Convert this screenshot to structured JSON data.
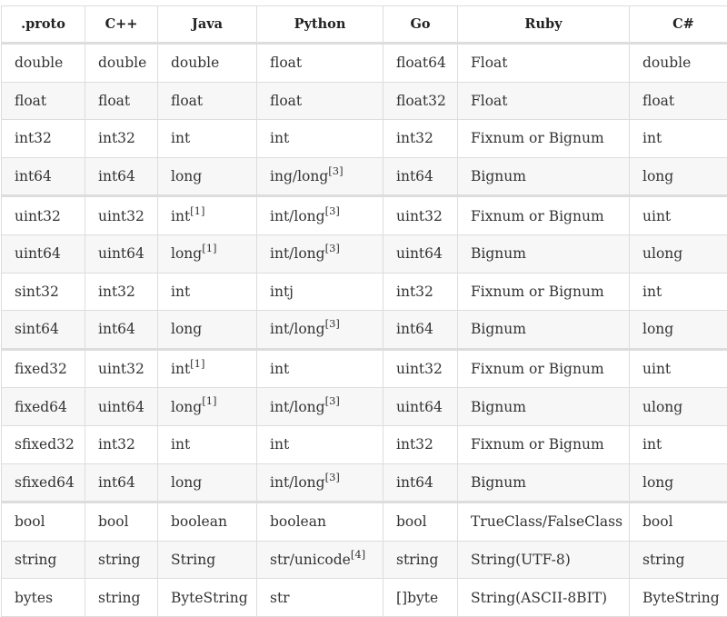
{
  "table": {
    "headers": [
      ".proto",
      "C++",
      "Java",
      "Python",
      "Go",
      "Ruby",
      "C#"
    ],
    "rows": [
      {
        "cells": [
          {
            "text": "double"
          },
          {
            "text": "double"
          },
          {
            "text": "double"
          },
          {
            "text": "float"
          },
          {
            "text": "float64"
          },
          {
            "text": "Float"
          },
          {
            "text": "double"
          }
        ]
      },
      {
        "cells": [
          {
            "text": "float"
          },
          {
            "text": "float"
          },
          {
            "text": "float"
          },
          {
            "text": "float"
          },
          {
            "text": "float32"
          },
          {
            "text": "Float"
          },
          {
            "text": "float"
          }
        ]
      },
      {
        "cells": [
          {
            "text": "int32"
          },
          {
            "text": "int32"
          },
          {
            "text": "int"
          },
          {
            "text": "int"
          },
          {
            "text": "int32"
          },
          {
            "text": "Fixnum or Bignum"
          },
          {
            "text": "int"
          }
        ]
      },
      {
        "cells": [
          {
            "text": "int64"
          },
          {
            "text": "int64"
          },
          {
            "text": "long"
          },
          {
            "text": "ing/long",
            "note": "[3]"
          },
          {
            "text": "int64"
          },
          {
            "text": "Bignum"
          },
          {
            "text": "long"
          }
        ]
      },
      {
        "cells": [
          {
            "text": "uint32"
          },
          {
            "text": "uint32"
          },
          {
            "text": "int",
            "note": "[1]"
          },
          {
            "text": "int/long",
            "note": "[3]"
          },
          {
            "text": "uint32"
          },
          {
            "text": "Fixnum or Bignum"
          },
          {
            "text": "uint"
          }
        ]
      },
      {
        "cells": [
          {
            "text": "uint64"
          },
          {
            "text": "uint64"
          },
          {
            "text": "long",
            "note": "[1]"
          },
          {
            "text": "int/long",
            "note": "[3]"
          },
          {
            "text": "uint64"
          },
          {
            "text": "Bignum"
          },
          {
            "text": "ulong"
          }
        ]
      },
      {
        "cells": [
          {
            "text": "sint32"
          },
          {
            "text": "int32"
          },
          {
            "text": "int"
          },
          {
            "text": "intj"
          },
          {
            "text": "int32"
          },
          {
            "text": "Fixnum or Bignum"
          },
          {
            "text": "int"
          }
        ]
      },
      {
        "cells": [
          {
            "text": "sint64"
          },
          {
            "text": "int64"
          },
          {
            "text": "long"
          },
          {
            "text": "int/long",
            "note": "[3]"
          },
          {
            "text": "int64"
          },
          {
            "text": "Bignum"
          },
          {
            "text": "long"
          }
        ]
      },
      {
        "cells": [
          {
            "text": "fixed32"
          },
          {
            "text": "uint32"
          },
          {
            "text": "int",
            "note": "[1]"
          },
          {
            "text": "int"
          },
          {
            "text": "uint32"
          },
          {
            "text": "Fixnum or Bignum"
          },
          {
            "text": "uint"
          }
        ]
      },
      {
        "cells": [
          {
            "text": "fixed64"
          },
          {
            "text": "uint64"
          },
          {
            "text": "long",
            "note": "[1]"
          },
          {
            "text": "int/long",
            "note": "[3]"
          },
          {
            "text": "uint64"
          },
          {
            "text": "Bignum"
          },
          {
            "text": "ulong"
          }
        ]
      },
      {
        "cells": [
          {
            "text": "sfixed32"
          },
          {
            "text": "int32"
          },
          {
            "text": "int"
          },
          {
            "text": "int"
          },
          {
            "text": "int32"
          },
          {
            "text": "Fixnum or Bignum"
          },
          {
            "text": "int"
          }
        ]
      },
      {
        "cells": [
          {
            "text": "sfixed64"
          },
          {
            "text": "int64"
          },
          {
            "text": "long"
          },
          {
            "text": "int/long",
            "note": "[3]"
          },
          {
            "text": "int64"
          },
          {
            "text": "Bignum"
          },
          {
            "text": "long"
          }
        ]
      },
      {
        "cells": [
          {
            "text": "bool"
          },
          {
            "text": "bool"
          },
          {
            "text": "boolean"
          },
          {
            "text": "boolean"
          },
          {
            "text": "bool"
          },
          {
            "text": "TrueClass/FalseClass"
          },
          {
            "text": "bool"
          }
        ]
      },
      {
        "cells": [
          {
            "text": "string"
          },
          {
            "text": "string"
          },
          {
            "text": "String"
          },
          {
            "text": "str/unicode",
            "note": "[4]"
          },
          {
            "text": "string"
          },
          {
            "text": "String(UTF-8)"
          },
          {
            "text": "string"
          }
        ]
      },
      {
        "cells": [
          {
            "text": "bytes"
          },
          {
            "text": "string"
          },
          {
            "text": "ByteString"
          },
          {
            "text": "str"
          },
          {
            "text": "[]byte"
          },
          {
            "text": "String(ASCII-8BIT)"
          },
          {
            "text": "ByteString"
          }
        ]
      }
    ]
  }
}
